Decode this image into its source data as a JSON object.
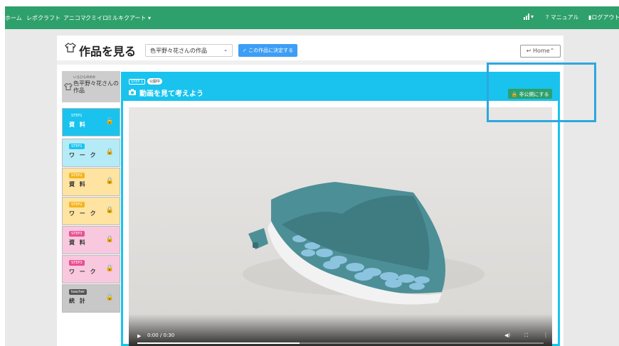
{
  "topnav": {
    "items": [
      "ホーム",
      "レポクラフト",
      "アニコマ",
      "クミイロ",
      "ミルキクアート ▾"
    ],
    "right_stats": "▾",
    "manual": "マニュアル",
    "logout": "ログアウト"
  },
  "header": {
    "title": "作品を見る",
    "select_value": "色平野々花さんの作品",
    "decide_label": "この作品に決定する",
    "home_label": "Home"
  },
  "sidebar": {
    "work_small": "いろひらののか",
    "work_name": "色平野々花さんの作品",
    "steps": [
      {
        "badge": "STEP1",
        "label": "資 料",
        "color": "#19c3ee",
        "lock": "🔓",
        "badge_color": "#19c3ee"
      },
      {
        "badge": "STEP1",
        "label": "ワ ー ク",
        "color": "#b5ebf7",
        "lock": "🔒",
        "badge_color": "#19c3ee"
      },
      {
        "badge": "STEP2",
        "label": "資 料",
        "color": "#ffe3a0",
        "lock": "🔒",
        "badge_color": "#f3b51c"
      },
      {
        "badge": "STEP2",
        "label": "ワ ー ク",
        "color": "#ffe3a0",
        "lock": "🔒",
        "badge_color": "#f3b51c"
      },
      {
        "badge": "STEP3",
        "label": "資 料",
        "color": "#f8c8df",
        "lock": "🔒",
        "badge_color": "#e84f92"
      },
      {
        "badge": "STEP3",
        "label": "ワ ー ク",
        "color": "#f8c8df",
        "lock": "🔒",
        "badge_color": "#e84f92"
      },
      {
        "badge": "teacher",
        "label": "統 計",
        "color": "#c8c8c8",
        "lock": "🔒",
        "badge_color": "#555555"
      }
    ]
  },
  "panel": {
    "step_badge": "STEP 1",
    "status_badge": "公開中",
    "title": "動画を見て考えよう",
    "private_button": "非公開にする"
  },
  "video": {
    "time": "0:00 / 0:30",
    "progress": 0.4
  },
  "colors": {
    "nav_green": "#2ea06b",
    "panel_cyan": "#19c3ee",
    "button_blue": "#3d9ef5",
    "highlight_blue": "#2ea7df"
  }
}
